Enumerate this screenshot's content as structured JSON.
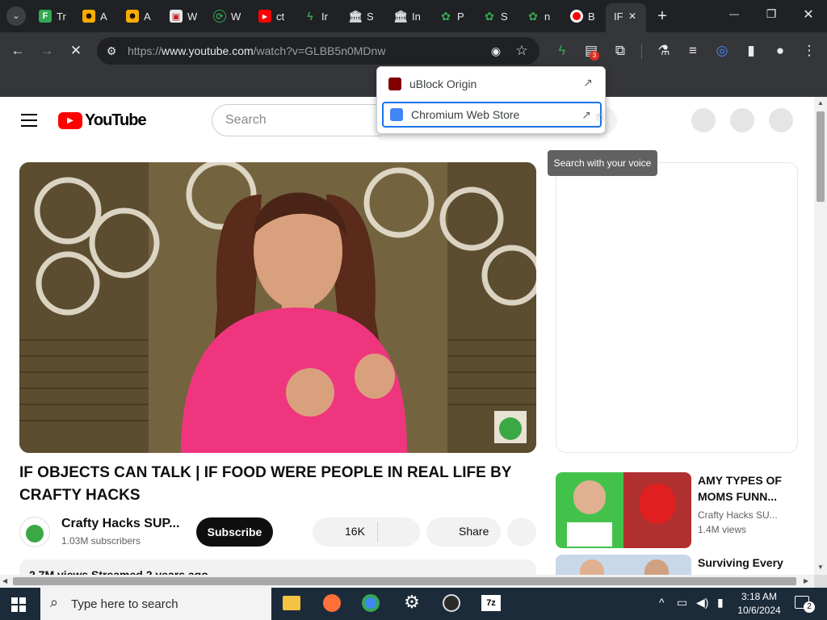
{
  "tabs": [
    {
      "title": "Tr",
      "fav_color": "#34a853"
    },
    {
      "title": "A",
      "fav_color": "#f9ab00"
    },
    {
      "title": "A",
      "fav_color": "#f9ab00"
    },
    {
      "title": "W",
      "fav_color": "#c5221f"
    },
    {
      "title": "W",
      "fav_color": "#34a853"
    },
    {
      "title": "ct",
      "fav_color": "#ff0000"
    },
    {
      "title": "Ir",
      "fav_color": "#34a853"
    },
    {
      "title": "S",
      "fav_color": "#dadce0"
    },
    {
      "title": "In",
      "fav_color": "#dadce0"
    },
    {
      "title": "P",
      "fav_color": "#34a853"
    },
    {
      "title": "S",
      "fav_color": "#34a853"
    },
    {
      "title": "n",
      "fav_color": "#34a853"
    },
    {
      "title": "B",
      "fav_color": "#ff0000"
    }
  ],
  "active_tab": {
    "title": "IF",
    "close": "✕"
  },
  "window_controls": {
    "minimize": "—",
    "restore": "❐",
    "close": "✕",
    "new_tab": "+"
  },
  "omnibox": {
    "url_prefix": "https://",
    "url_host": "www.youtube.com",
    "url_path": "/watch?v=GLBB5n0MDnw"
  },
  "extensions_badge": "3",
  "ext_popup": [
    {
      "name": "uBlock Origin",
      "icon_color": "#800000"
    },
    {
      "name": "Chromium Web Store",
      "icon_color": "#4285f4"
    }
  ],
  "tooltip": "Search with your voice",
  "youtube": {
    "logo_text": "YouTube",
    "search_placeholder": "Search",
    "video_title": "IF OBJECTS CAN TALK | IF FOOD WERE PEOPLE IN REAL LIFE BY CRAFTY HACKS",
    "channel_name": "Crafty Hacks SUP...",
    "subscribers": "1.03M subscribers",
    "subscribe_label": "Subscribe",
    "likes": "16K",
    "share_label": "Share",
    "views_line": "2.7M views  Streamed 2 years ago",
    "related": [
      {
        "title_line1": "AMY TYPES OF",
        "title_line2": "MOMS FUNN...",
        "channel": "Crafty Hacks SU...",
        "views": "1.4M views"
      },
      {
        "title_line1": "Surviving Every",
        "title_line2": "",
        "channel": "",
        "views": ""
      }
    ]
  },
  "taskbar": {
    "search_placeholder": "Type here to search",
    "time": "3:18 AM",
    "date": "10/6/2024",
    "notification_count": "2"
  },
  "colors": {
    "yt_red": "#ff0000",
    "accent_blue": "#1a73e8",
    "chrome_dark": "#202124",
    "chrome_toolbar": "#35363a"
  }
}
